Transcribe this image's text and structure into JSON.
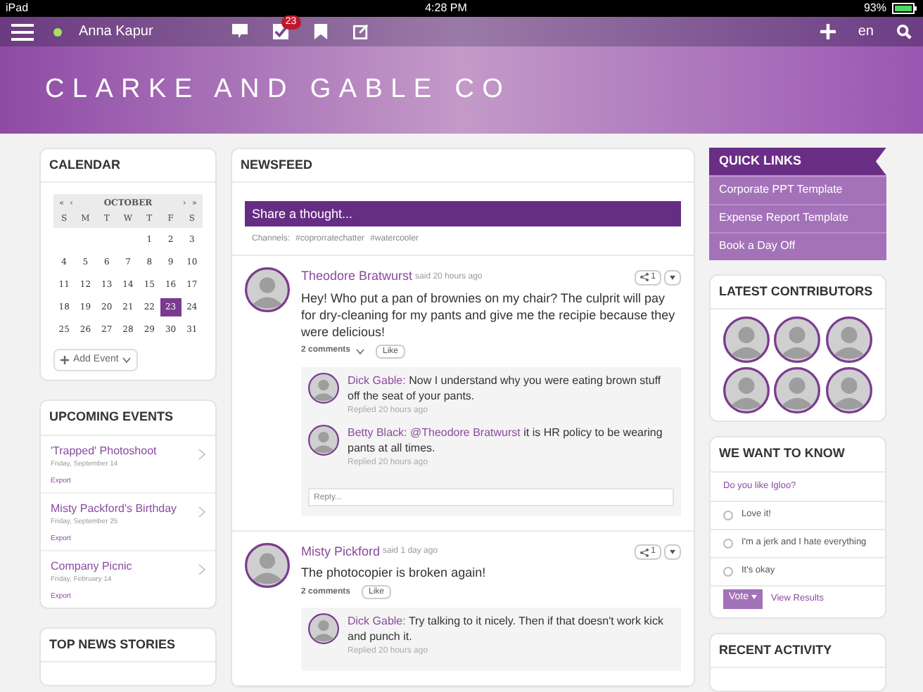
{
  "status_bar": {
    "device": "iPad",
    "time": "4:28 PM",
    "battery": "93%"
  },
  "nav": {
    "user": "Anna Kapur",
    "online": true,
    "tasks_badge": "23",
    "language": "en"
  },
  "banner": {
    "title": "CLARKE AND GABLE CO"
  },
  "calendar": {
    "title": "CALENDAR",
    "month": "OCTOBER",
    "first_nav": "«",
    "prev_nav": "‹",
    "next_nav": "›",
    "last_nav": "»",
    "weekdays": [
      "S",
      "M",
      "T",
      "W",
      "T",
      "F",
      "S"
    ],
    "weeks": [
      [
        {
          "day": "1",
          "selected": false
        },
        {
          "day": "2",
          "selected": false
        },
        {
          "day": "3",
          "selected": false
        }
      ],
      [
        {
          "day": "4",
          "selected": false
        },
        {
          "day": "5",
          "selected": false
        },
        {
          "day": "6",
          "selected": false
        },
        {
          "day": "7",
          "selected": false
        },
        {
          "day": "8",
          "selected": false
        },
        {
          "day": "9",
          "selected": false
        },
        {
          "day": "10",
          "selected": false
        }
      ],
      [
        {
          "day": "11",
          "selected": false
        },
        {
          "day": "12",
          "selected": false
        },
        {
          "day": "13",
          "selected": false
        },
        {
          "day": "14",
          "selected": false
        },
        {
          "day": "15",
          "selected": false
        },
        {
          "day": "16",
          "selected": false
        },
        {
          "day": "17",
          "selected": false
        }
      ],
      [
        {
          "day": "18",
          "selected": false
        },
        {
          "day": "19",
          "selected": false
        },
        {
          "day": "20",
          "selected": false
        },
        {
          "day": "21",
          "selected": false
        },
        {
          "day": "22",
          "selected": false
        },
        {
          "day": "23",
          "selected": true
        },
        {
          "day": "24",
          "selected": false
        }
      ],
      [
        {
          "day": "25",
          "selected": false
        },
        {
          "day": "26",
          "selected": false
        },
        {
          "day": "27",
          "selected": false
        },
        {
          "day": "28",
          "selected": false
        },
        {
          "day": "29",
          "selected": false
        },
        {
          "day": "30",
          "selected": false
        },
        {
          "day": "31",
          "selected": false
        }
      ]
    ],
    "add_event": "Add Event"
  },
  "upcoming_events": {
    "title": "UPCOMING EVENTS",
    "items": [
      {
        "name": "'Trapped' Photoshoot",
        "date": "Friday, September 14",
        "export": "Export"
      },
      {
        "name": "Misty Packford's Birthday",
        "date": "Friday, September 25",
        "export": "Export"
      },
      {
        "name": "Company Picnic",
        "date": "Friday, February 14",
        "export": "Export"
      }
    ]
  },
  "top_news": {
    "title": "TOP NEWS STORIES"
  },
  "newsfeed": {
    "title": "NEWSFEED",
    "share_placeholder": "Share a thought...",
    "channels_label": "Channels:",
    "channels": [
      "#coprorratechatter",
      "#watercooler"
    ],
    "posts": [
      {
        "author": "Theodore Bratwurst",
        "time": "said 20 hours ago",
        "text": "Hey! Who put a pan of brownies on my chair? The culprit will pay for dry-cleaning for my pants and give me the recipie because they were delicious!",
        "shares": "1",
        "comments_label": "2 comments",
        "comments_expandable": true,
        "like": "Like",
        "replies": [
          {
            "author": "Dick Gable:",
            "text": "Now I understand why you were eating brown stuff off the seat of your pants.",
            "time": "Replied 20 hours ago"
          },
          {
            "author": "Betty Black:",
            "mention": "@Theodore Bratwurst",
            "text": "it is HR policy to be wearing pants at all times.",
            "time": "Replied 20 hours ago"
          }
        ],
        "reply_placeholder": "Reply..."
      },
      {
        "author": "Misty Pickford",
        "time": "said 1 day ago",
        "text": "The photocopier is broken again!",
        "shares": "1",
        "comments_label": "2 comments",
        "comments_expandable": false,
        "like": "Like",
        "replies": [
          {
            "author": "Dick Gable:",
            "text": "Try talking to it nicely. Then if that doesn't work kick and punch it.",
            "time": "Replied 20 hours ago"
          }
        ]
      }
    ]
  },
  "quick_links": {
    "title": "QUICK LINKS",
    "items": [
      "Corporate PPT Template",
      "Expense Report Template",
      "Book a Day Off"
    ]
  },
  "latest_contributors": {
    "title": "LATEST CONTRIBUTORS",
    "contributors": [
      {
        "kind": "avatar"
      },
      {
        "kind": "avatar"
      },
      {
        "kind": "avatar"
      },
      {
        "kind": "avatar"
      },
      {
        "kind": "avatar"
      },
      {
        "kind": "avatar"
      }
    ]
  },
  "poll": {
    "title": "WE WANT TO KNOW",
    "question": "Do you like Igloo?",
    "options": [
      {
        "label": "Love it!",
        "selected": false
      },
      {
        "label": "I'm a jerk and I hate everything",
        "selected": false
      },
      {
        "label": "It's okay",
        "selected": false
      }
    ],
    "vote": "Vote",
    "results": "View Results"
  },
  "recent_activity": {
    "title": "RECENT ACTIVITY"
  }
}
